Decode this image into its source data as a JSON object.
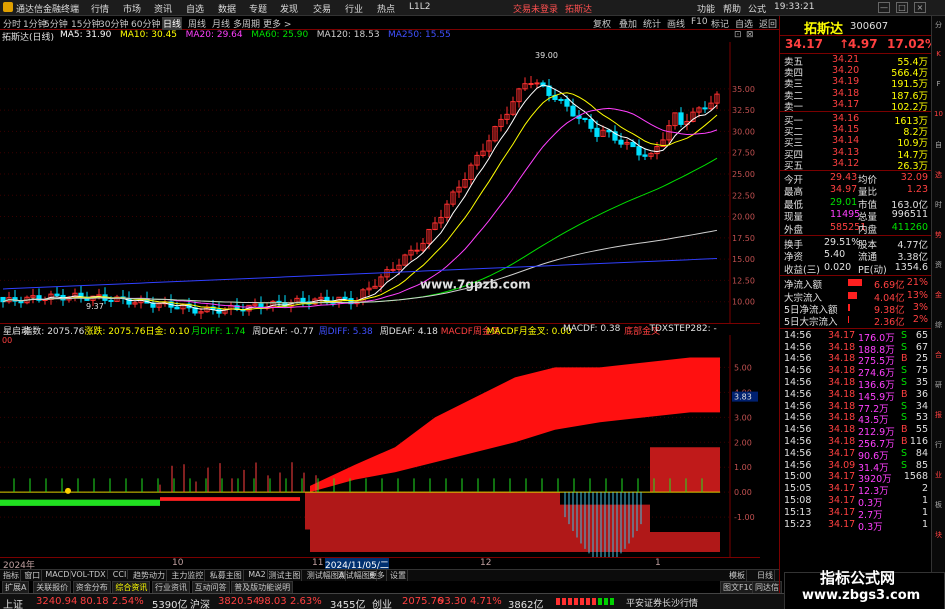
{
  "app": {
    "title": "通达信金融终端",
    "menu": [
      "行情",
      "市场",
      "资讯",
      "自选",
      "数据",
      "专题",
      "发现",
      "交易",
      "行业",
      "热点",
      "L1L2"
    ],
    "promo": [
      "交易未登录",
      "拓斯达"
    ],
    "window_menu": [
      "功能",
      "帮助",
      "公式",
      "19:33:21"
    ],
    "window_buttons": [
      "—",
      "□",
      "×"
    ]
  },
  "periods": [
    "分时",
    "1分钟",
    "5分钟",
    "15分钟",
    "30分钟",
    "60分钟",
    "日线",
    "周线",
    "月线",
    "多周期",
    "更多 >"
  ],
  "toolbar_right": [
    "复权",
    "叠加",
    "统计",
    "画线",
    "F10",
    "标记",
    "自选",
    "返回"
  ],
  "chart_title": "拓斯达(日线)",
  "ma": [
    {
      "label": "MA5: 31.90",
      "color": "#ffffff"
    },
    {
      "label": "MA10: 30.45",
      "color": "#ffff00"
    },
    {
      "label": "MA20: 29.64",
      "color": "#ff40ff"
    },
    {
      "label": "MA60: 25.90",
      "color": "#00e000"
    },
    {
      "label": "MA120: 18.53",
      "color": "#d0d0d0"
    },
    {
      "label": "MA250: 15.55",
      "color": "#4050ff"
    }
  ],
  "price_axis": [
    "35.00",
    "32.50",
    "30.00",
    "27.50",
    "25.00",
    "22.50",
    "20.00",
    "17.50",
    "15.00",
    "12.50",
    "10.00"
  ],
  "price_axis_values": [
    35,
    32.5,
    30,
    27.5,
    25,
    22.5,
    20,
    17.5,
    15,
    12.5,
    10
  ],
  "high_label": "39.00",
  "low_label": "9.37",
  "watermark": "www.7gpzb.com",
  "sub_header": [
    {
      "t": "星启动",
      "c": "#e0e0e0"
    },
    {
      "t": "指数: 2075.76",
      "c": "#e0e0e0"
    },
    {
      "t": "涨跌: 2075.76",
      "c": "#ffff00"
    },
    {
      "t": "日金: 0.10",
      "c": "#ffff00"
    },
    {
      "t": "月DIFF: 1.74",
      "c": "#00e000"
    },
    {
      "t": "周DEAF: -0.77",
      "c": "#e0e0e0"
    },
    {
      "t": "周DIFF: 5.38",
      "c": "#4050ff"
    },
    {
      "t": "周DEAF: 4.18",
      "c": "#e0e0e0"
    },
    {
      "t": "MACDF周金叉",
      "c": "#ff4040"
    },
    {
      "t": "MACDF月金叉: 0.00",
      "c": "#ffff00"
    },
    {
      "t": "MACDF: 0.38",
      "c": "#e0e0e0"
    },
    {
      "t": "底部金叉",
      "c": "#ff4040"
    },
    {
      "t": "TDXSTEP282: -",
      "c": "#e0e0e0"
    }
  ],
  "sub_axis": [
    "5.00",
    "4.00",
    "3.00",
    "2.00",
    "1.00",
    "0.00",
    "-1.00"
  ],
  "sub_axis_values": [
    5,
    4,
    3,
    2,
    1,
    0,
    -1
  ],
  "sub_marker": "3.83",
  "sub_zero": "00",
  "x_axis": [
    "2024年",
    "10",
    "11",
    "2024/11/05/二",
    "12",
    "1"
  ],
  "tabs": [
    "指标",
    "窗口",
    "MACD",
    "VOL-TDX",
    "CCI",
    "趋势动力",
    "主力监控",
    "私募主图",
    "MA2",
    "测试主图",
    "测试幅图A",
    "测试幅图B",
    "更多",
    "设置"
  ],
  "tabs_right": [
    "模板",
    "日线"
  ],
  "tabs2": [
    "扩展A",
    "关联报价",
    "资金分布",
    "综合资讯",
    "行业资讯",
    "互动问答",
    "普及版功能说明"
  ],
  "tabs2_right": [
    "图文F10",
    "同达信"
  ],
  "quote": {
    "name": "拓斯达",
    "code": "300607",
    "price": "34.17",
    "change": "4.97",
    "pct": "17.02%"
  },
  "sell": [
    {
      "l": "卖五",
      "p": "34.21",
      "v": "55.4万"
    },
    {
      "l": "卖四",
      "p": "34.20",
      "v": "566.4万"
    },
    {
      "l": "卖三",
      "p": "34.19",
      "v": "191.5万"
    },
    {
      "l": "卖二",
      "p": "34.18",
      "v": "187.6万"
    },
    {
      "l": "卖一",
      "p": "34.17",
      "v": "102.2万"
    }
  ],
  "buy": [
    {
      "l": "买一",
      "p": "34.16",
      "v": "1613万"
    },
    {
      "l": "买二",
      "p": "34.15",
      "v": "8.2万"
    },
    {
      "l": "买三",
      "p": "34.14",
      "v": "10.9万"
    },
    {
      "l": "买四",
      "p": "34.13",
      "v": "14.7万"
    },
    {
      "l": "买五",
      "p": "34.12",
      "v": "26.3万"
    }
  ],
  "stats": [
    {
      "a": "今开",
      "av": "29.43",
      "ac": "#ff4040",
      "b": "均价",
      "bv": "32.09",
      "bc": "#ff4040"
    },
    {
      "a": "最高",
      "av": "34.97",
      "ac": "#ff4040",
      "b": "量比",
      "bv": "1.23",
      "bc": "#ff4040"
    },
    {
      "a": "最低",
      "av": "29.01",
      "ac": "#00e000",
      "b": "市值",
      "bv": "163.0亿",
      "bc": "#e0e0e0"
    },
    {
      "a": "现量",
      "av": "11495",
      "ac": "#ff40ff",
      "b": "总量",
      "bv": "996511",
      "bc": "#e0e0e0"
    },
    {
      "a": "外盘",
      "av": "585251",
      "ac": "#ff4040",
      "b": "内盘",
      "bv": "411260",
      "bc": "#00e000"
    }
  ],
  "stats2": [
    {
      "a": "换手",
      "av": "29.51%",
      "b": "股本",
      "bv": "4.77亿"
    },
    {
      "a": "净资",
      "av": "5.40",
      "b": "流通",
      "bv": "3.38亿"
    },
    {
      "a": "收益(三)",
      "av": "0.020",
      "b": "PE(动)",
      "bv": "1354.6"
    }
  ],
  "flows": [
    {
      "l": "净流入额",
      "v": "6.69亿",
      "p": "21%",
      "w": 40
    },
    {
      "l": "大宗流入",
      "v": "4.04亿",
      "p": "13%",
      "w": 25
    },
    {
      "l": "5日净流入额",
      "v": "9.38亿",
      "p": "3%",
      "w": 6
    },
    {
      "l": "5日大宗流入",
      "v": "2.36亿",
      "p": "2%",
      "w": 4
    }
  ],
  "ticks": [
    {
      "t": "14:56",
      "p": "34.17",
      "v": "176.0万",
      "f": "S",
      "n": "65"
    },
    {
      "t": "14:56",
      "p": "34.18",
      "v": "188.8万",
      "f": "S",
      "n": "67"
    },
    {
      "t": "14:56",
      "p": "34.18",
      "v": "275.5万",
      "f": "B",
      "n": "25"
    },
    {
      "t": "14:56",
      "p": "34.18",
      "v": "274.6万",
      "f": "S",
      "n": "75"
    },
    {
      "t": "14:56",
      "p": "34.18",
      "v": "136.6万",
      "f": "S",
      "n": "35"
    },
    {
      "t": "14:56",
      "p": "34.18",
      "v": "145.9万",
      "f": "B",
      "n": "36"
    },
    {
      "t": "14:56",
      "p": "34.18",
      "v": "77.2万",
      "f": "S",
      "n": "34"
    },
    {
      "t": "14:56",
      "p": "34.18",
      "v": "43.5万",
      "f": "S",
      "n": "53"
    },
    {
      "t": "14:56",
      "p": "34.18",
      "v": "212.9万",
      "f": "B",
      "n": "55"
    },
    {
      "t": "14:56",
      "p": "34.18",
      "v": "256.7万",
      "f": "B",
      "n": "116"
    },
    {
      "t": "14:56",
      "p": "34.17",
      "v": "90.6万",
      "f": "S",
      "n": "84"
    },
    {
      "t": "14:56",
      "p": "34.09",
      "v": "31.4万",
      "f": "S",
      "n": "85"
    },
    {
      "t": "15:00",
      "p": "34.17",
      "v": "3920万",
      "f": "",
      "n": "1568"
    },
    {
      "t": "15:05",
      "p": "34.17",
      "v": "12.3万",
      "f": "",
      "n": "2"
    },
    {
      "t": "15:08",
      "p": "34.17",
      "v": "0.3万",
      "f": "",
      "n": "1"
    },
    {
      "t": "15:13",
      "p": "34.17",
      "v": "2.7万",
      "f": "",
      "n": "1"
    },
    {
      "t": "15:23",
      "p": "34.17",
      "v": "0.3万",
      "f": "",
      "n": "1"
    }
  ],
  "status": [
    {
      "t": "上证",
      "c": "#e0e0e0"
    },
    {
      "t": "3240.94",
      "c": "#ff4040"
    },
    {
      "t": "80.18",
      "c": "#ff4040"
    },
    {
      "t": "2.54%",
      "c": "#ff4040"
    },
    {
      "t": "5390亿",
      "c": "#e0e0e0"
    },
    {
      "t": "沪深",
      "c": "#e0e0e0"
    },
    {
      "t": "3820.54",
      "c": "#ff4040"
    },
    {
      "t": "98.03",
      "c": "#ff4040"
    },
    {
      "t": "2.63%",
      "c": "#ff4040"
    },
    {
      "t": "3455亿",
      "c": "#e0e0e0"
    },
    {
      "t": "创业",
      "c": "#e0e0e0"
    },
    {
      "t": "2075.76",
      "c": "#ff4040"
    },
    {
      "t": "93.30",
      "c": "#ff4040"
    },
    {
      "t": "4.71%",
      "c": "#ff4040"
    },
    {
      "t": "3862亿",
      "c": "#e0e0e0"
    }
  ],
  "status_right": "平安证券长沙行情",
  "brand": {
    "name": "指标公式网",
    "url": "www.zbgs3.com"
  },
  "side_icons": [
    "分",
    "K",
    "F",
    "10",
    "自",
    "选",
    "时",
    "势",
    "资",
    "金",
    "综",
    "合",
    "研",
    "报",
    "行",
    "业",
    "板",
    "块"
  ]
}
